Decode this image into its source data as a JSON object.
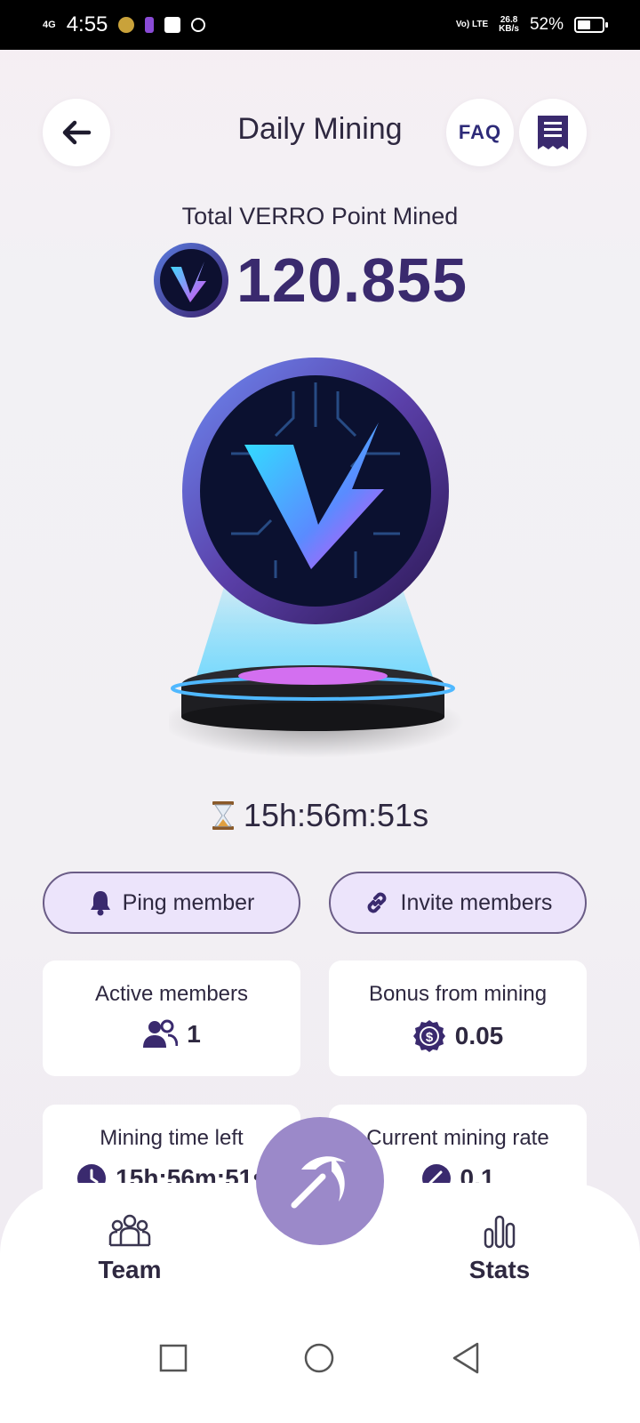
{
  "status_bar": {
    "network": "4G",
    "time": "4:55",
    "volte": "Vo) LTE",
    "speed_value": "26.8",
    "speed_unit": "KB/s",
    "battery": "52%",
    "battery_level": 0.52
  },
  "header": {
    "title": "Daily Mining",
    "faq_label": "FAQ"
  },
  "total": {
    "label": "Total VERRO Point Mined",
    "value": "120.855"
  },
  "timer": "15h:56m:51s",
  "actions": {
    "ping_label": "Ping member",
    "invite_label": "Invite members"
  },
  "stats": {
    "active_members_label": "Active members",
    "active_members_value": "1",
    "bonus_label": "Bonus from mining",
    "bonus_value": "0.05",
    "time_left_label": "Mining time left",
    "time_left_value": "15h:56m:51s",
    "rate_label": "Current mining rate",
    "rate_value": "0.1"
  },
  "bottom_nav": {
    "team_label": "Team",
    "stats_label": "Stats"
  },
  "colors": {
    "accent": "#3a2a6e",
    "pill_bg": "#ece4fb",
    "mine_button": "#9b89c9"
  }
}
